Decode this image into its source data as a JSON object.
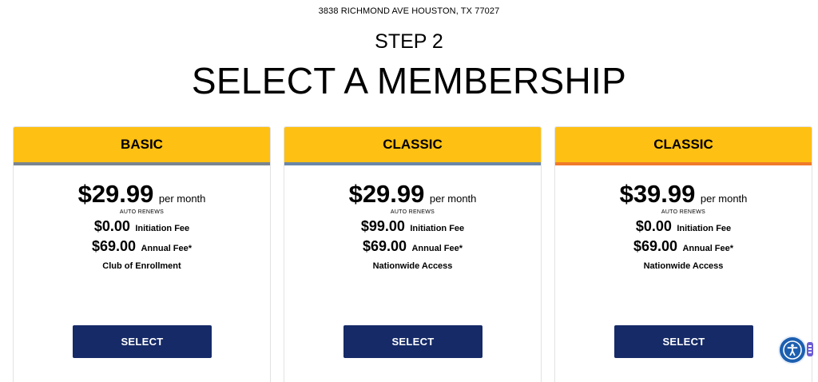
{
  "header": {
    "address": "3838 RICHMOND AVE HOUSTON, TX 77027",
    "step": "STEP 2",
    "title": "SELECT A MEMBERSHIP"
  },
  "plans": [
    {
      "name": "BASIC",
      "price": "$29.99",
      "per_month": "per month",
      "auto_renews": "AUTO RENEWS",
      "initiation_amount": "$0.00",
      "initiation_label": "Initiation Fee",
      "annual_amount": "$69.00",
      "annual_label": "Annual Fee*",
      "note": "Club of Enrollment",
      "button": "SELECT",
      "stripe_color": "#7a8590"
    },
    {
      "name": "CLASSIC",
      "price": "$29.99",
      "per_month": "per month",
      "auto_renews": "AUTO RENEWS",
      "initiation_amount": "$99.00",
      "initiation_label": "Initiation Fee",
      "annual_amount": "$69.00",
      "annual_label": "Annual Fee*",
      "note": "Nationwide Access",
      "button": "SELECT",
      "stripe_color": "#6a87a8"
    },
    {
      "name": "CLASSIC",
      "price": "$39.99",
      "per_month": "per month",
      "auto_renews": "AUTO RENEWS",
      "initiation_amount": "$0.00",
      "initiation_label": "Initiation Fee",
      "annual_amount": "$69.00",
      "annual_label": "Annual Fee*",
      "note": "Nationwide Access",
      "button": "SELECT",
      "stripe_color": "#f07a2a"
    }
  ],
  "theme": {
    "header_yellow": "#fec013",
    "button_navy": "#152a67",
    "accessibility_blue": "#1c5fb0"
  },
  "accessibility_widget": {
    "icon": "accessibility-icon"
  }
}
